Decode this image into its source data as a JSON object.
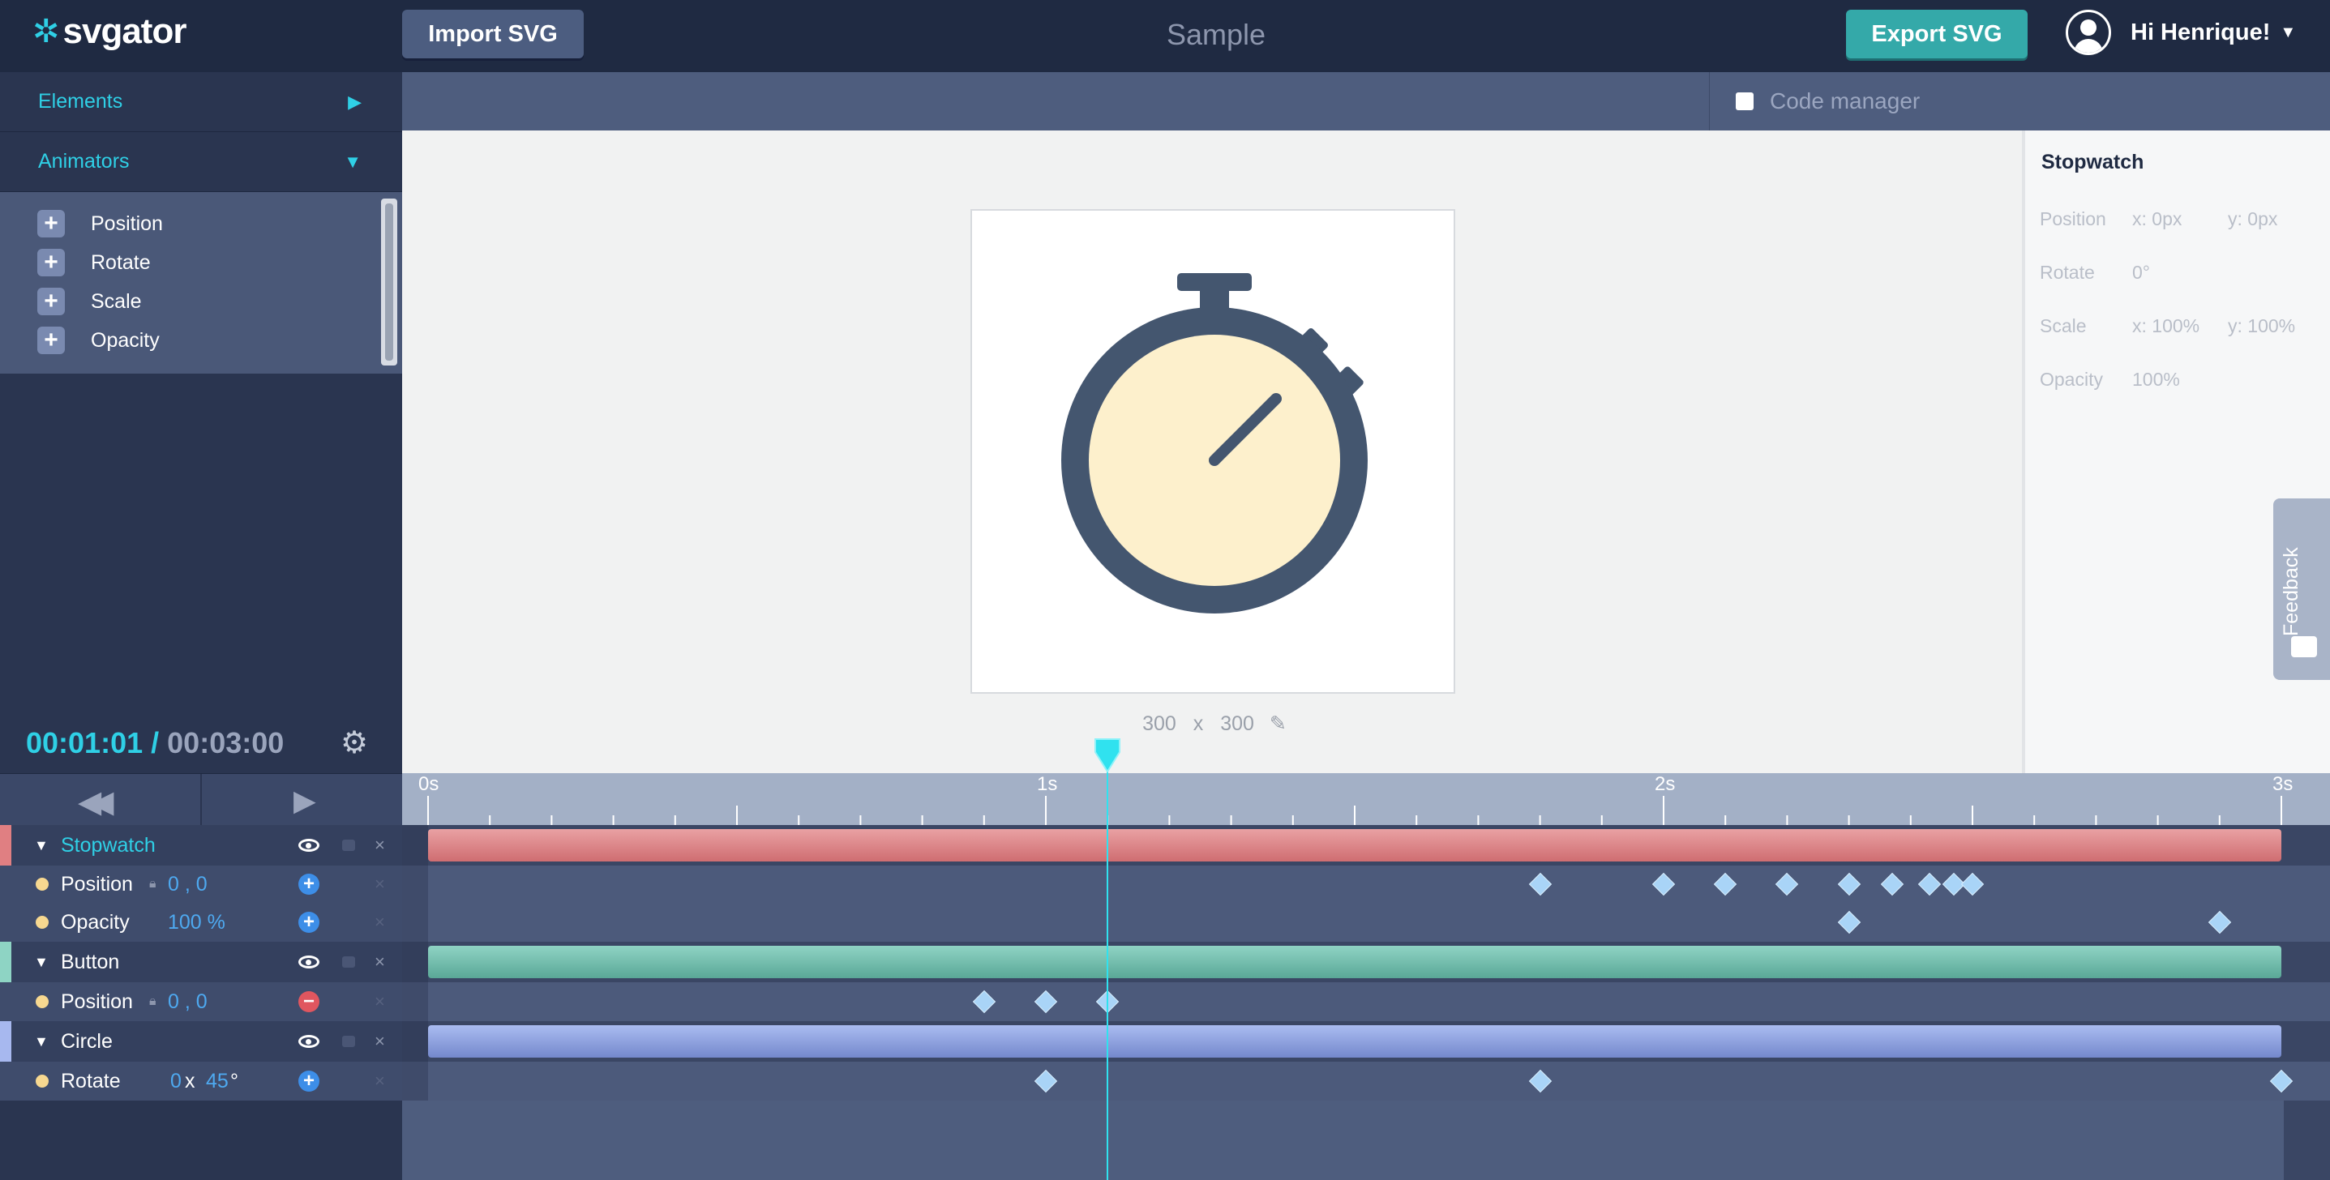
{
  "header": {
    "logo": "svgator",
    "import_label": "Import SVG",
    "project_title": "Sample",
    "export_label": "Export SVG",
    "greeting": "Hi Henrique!"
  },
  "sidebar": {
    "elements_label": "Elements",
    "animators_label": "Animators",
    "animators": [
      {
        "label": "Position"
      },
      {
        "label": "Rotate"
      },
      {
        "label": "Scale"
      },
      {
        "label": "Opacity"
      }
    ]
  },
  "playback": {
    "current_time": "00:01:01",
    "separator": "/",
    "total_time": "00:03:00",
    "playhead_seconds": 1.1
  },
  "canvas": {
    "code_manager_label": "Code manager",
    "code_manager_checked": false,
    "width": "300",
    "height": "300",
    "size_x": "x"
  },
  "properties": {
    "title": "Stopwatch",
    "position_label": "Position",
    "position_x": "x: 0px",
    "position_y": "y: 0px",
    "rotate_label": "Rotate",
    "rotate_value": "0°",
    "scale_label": "Scale",
    "scale_x": "x: 100%",
    "scale_y": "y: 100%",
    "opacity_label": "Opacity",
    "opacity_value": "100%"
  },
  "feedback_label": "Feedback",
  "timeline": {
    "ruler_labels": [
      "0s",
      "1s",
      "2s",
      "3s"
    ],
    "duration_seconds": 3,
    "rows": [
      {
        "type": "element",
        "name": "Stopwatch",
        "color": "#e07f82",
        "stripe": "#e07f82",
        "active": true
      },
      {
        "type": "property",
        "name": "Position",
        "value": "0 , 0",
        "locked_icon": true,
        "kf_button": "add",
        "keyframes": [
          1.8,
          2.0,
          2.1,
          2.2,
          2.3,
          2.37,
          2.43,
          2.47,
          2.5
        ]
      },
      {
        "type": "property",
        "name": "Opacity",
        "value": "100 %",
        "kf_button": "add",
        "keyframes": [
          2.3,
          2.9
        ]
      },
      {
        "type": "element",
        "name": "Button",
        "color": "#6cc2b0",
        "stripe": "#8ed4c4",
        "active": false
      },
      {
        "type": "property",
        "name": "Position",
        "value": "0 , 0",
        "locked_icon": true,
        "kf_button": "remove",
        "keyframes": [
          0.9,
          1.0,
          1.1
        ]
      },
      {
        "type": "element",
        "name": "Circle",
        "color": "#8da2e0",
        "stripe": "#a7b8ef",
        "active": false
      },
      {
        "type": "property",
        "name": "Rotate",
        "value_turns": "0",
        "value_x": "x",
        "value_deg": "45",
        "value_unit": "°",
        "kf_button": "add",
        "keyframes": [
          1.0,
          1.8,
          3.0
        ]
      }
    ]
  },
  "colors": {
    "accent": "#2fd0e6",
    "export": "#34a9a9",
    "stopwatch_face": "#fdf0cc",
    "stopwatch_body": "#44566f"
  }
}
